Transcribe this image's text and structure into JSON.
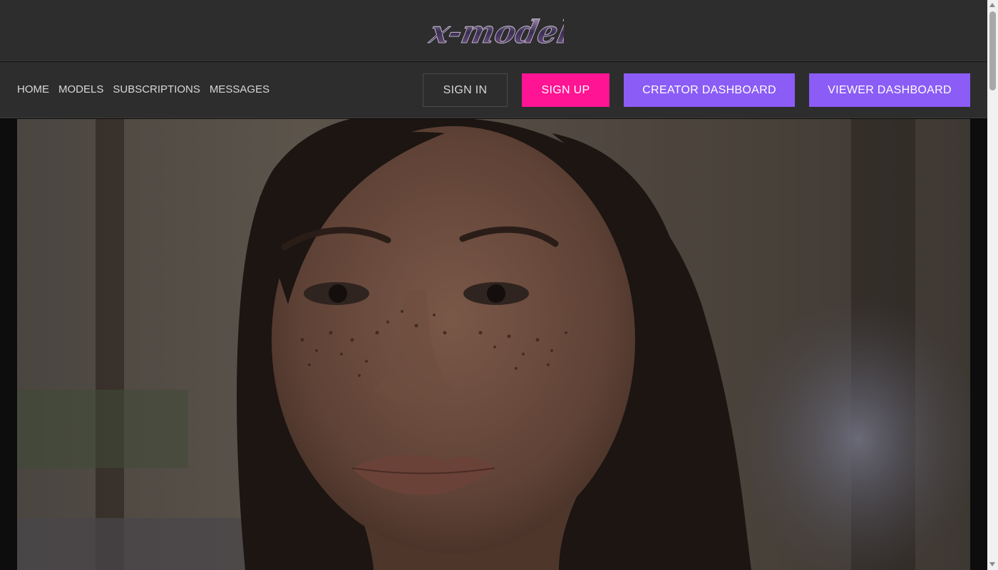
{
  "brand": {
    "logo_text": "x-models",
    "logo_icon": "x-models-logo"
  },
  "nav": {
    "links": [
      {
        "label": "HOME"
      },
      {
        "label": "MODELS"
      },
      {
        "label": "SUBSCRIPTIONS"
      },
      {
        "label": "MESSAGES"
      }
    ]
  },
  "actions": {
    "sign_in": "SIGN IN",
    "sign_up": "SIGN UP",
    "creator_dashboard": "CREATOR DASHBOARD",
    "viewer_dashboard": "VIEWER DASHBOARD"
  },
  "colors": {
    "header_bg": "#2d2d2d",
    "signup_accent": "#ff1493",
    "dashboard_accent": "#8b5cf6",
    "page_bg": "#0d0d0d"
  },
  "hero": {
    "icon": "model-portrait-photo"
  }
}
